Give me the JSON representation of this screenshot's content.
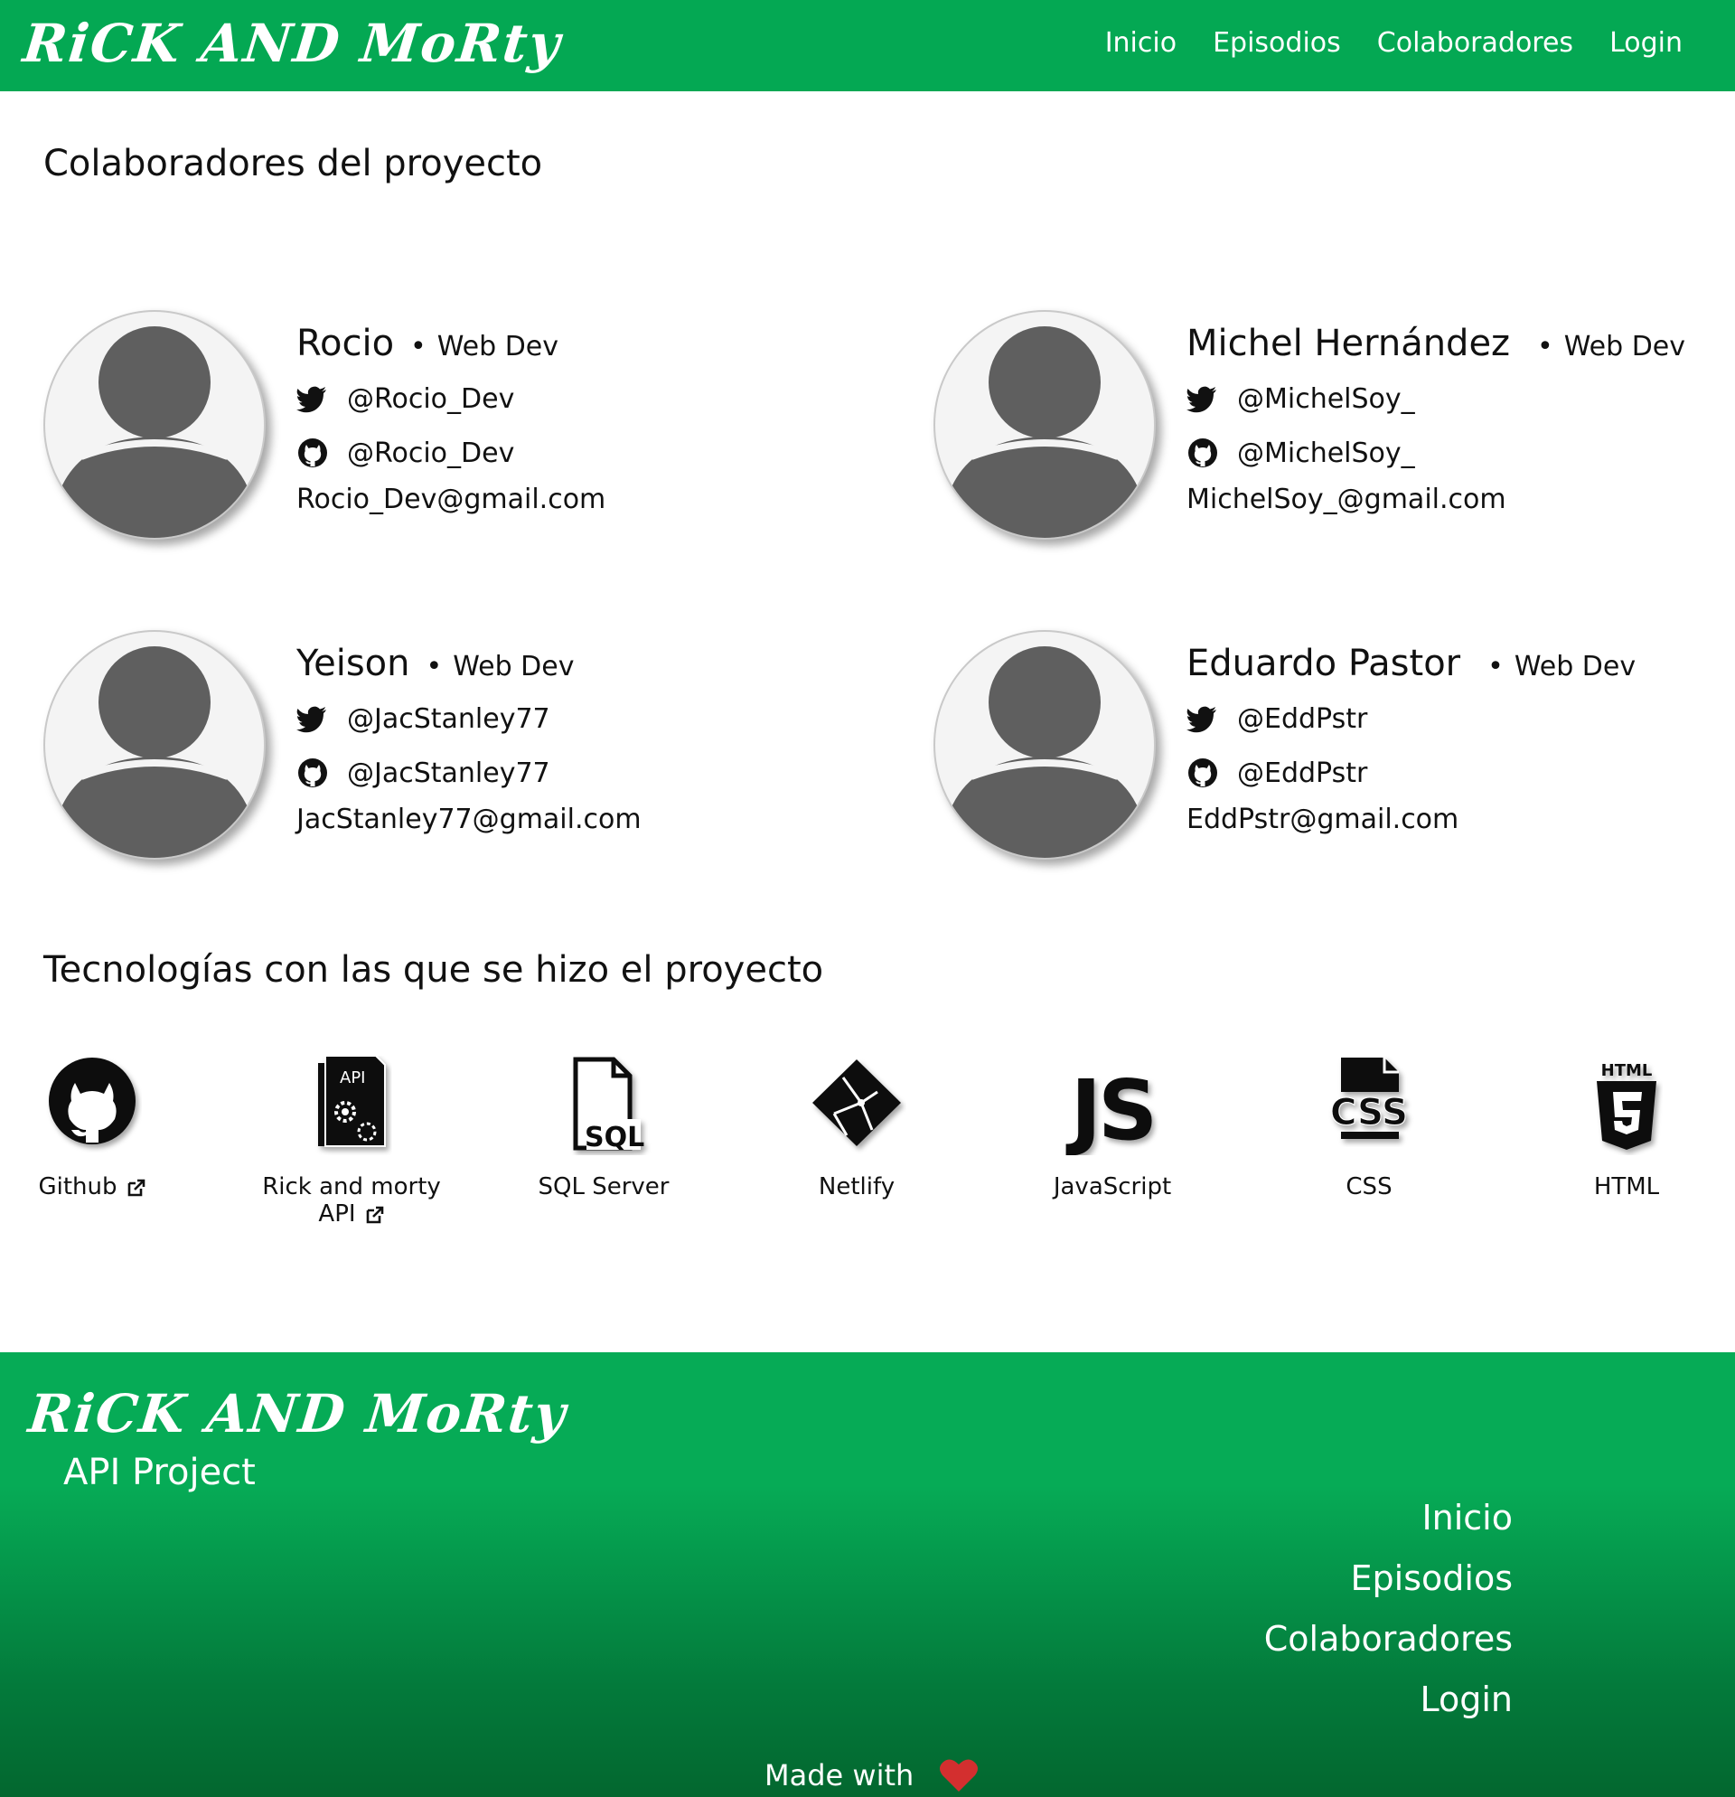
{
  "header": {
    "logo_text": "RiCK AND MoRty",
    "nav": [
      "Inicio",
      "Episodios",
      "Colaboradores",
      "Login"
    ]
  },
  "collaborators": {
    "title": "Colaboradores del proyecto",
    "people": [
      {
        "name": "Rocio",
        "role": "Web Dev",
        "twitter": "@Rocio_Dev",
        "github": "@Rocio_Dev",
        "email": "Rocio_Dev@gmail.com"
      },
      {
        "name": "Michel Hernández",
        "role": "Web Dev",
        "twitter": "@MichelSoy_",
        "github": "@MichelSoy_",
        "email": "MichelSoy_@gmail.com"
      },
      {
        "name": "Yeison",
        "role": "Web Dev",
        "twitter": "@JacStanley77",
        "github": "@JacStanley77",
        "email": "JacStanley77@gmail.com"
      },
      {
        "name": "Eduardo Pastor",
        "role": "Web Dev",
        "twitter": "@EddPstr",
        "github": "@EddPstr",
        "email": "EddPstr@gmail.com"
      }
    ]
  },
  "technologies": {
    "title": "Tecnologías con las que se hizo el proyecto",
    "items": [
      {
        "label": "Github",
        "icon": "github-icon",
        "external": true
      },
      {
        "label": "Rick and morty API",
        "icon": "api-file-icon",
        "external": true
      },
      {
        "label": "SQL Server",
        "icon": "sql-file-icon",
        "external": false
      },
      {
        "label": "Netlify",
        "icon": "netlify-icon",
        "external": false
      },
      {
        "label": "JavaScript",
        "icon": "javascript-icon",
        "external": false
      },
      {
        "label": "CSS",
        "icon": "css-file-icon",
        "external": false
      },
      {
        "label": "HTML",
        "icon": "html5-icon",
        "external": false
      }
    ]
  },
  "footer": {
    "logo_text": "RiCK AND MoRty",
    "subtitle": "API Project",
    "nav": [
      "Inicio",
      "Episodios",
      "Colaboradores",
      "Login"
    ],
    "made_with": "Made with"
  },
  "colors": {
    "brand_green": "#04a853",
    "footer_dark_green": "#03672f",
    "heart_red": "#d32f2f",
    "avatar_gray": "#5f5f5f"
  }
}
